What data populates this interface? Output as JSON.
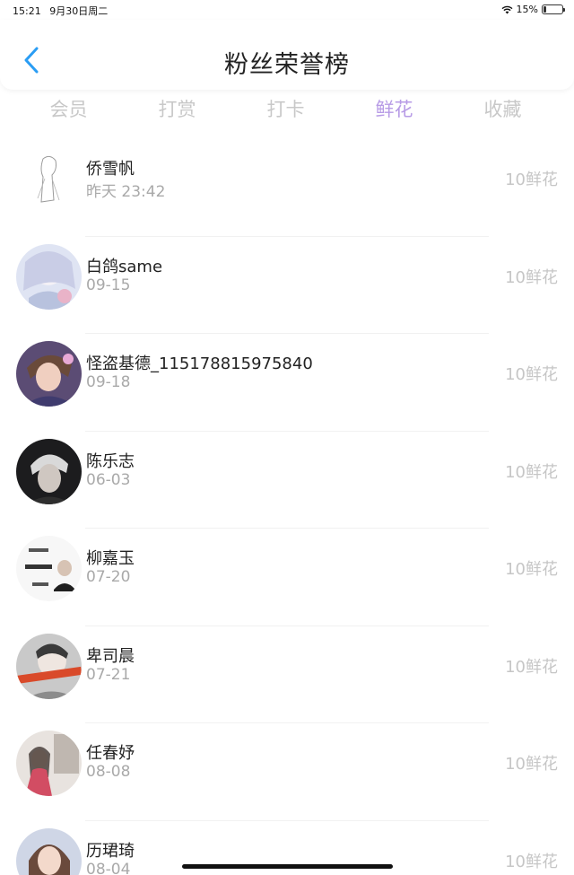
{
  "status_bar": {
    "time": "15:21",
    "date": "9月30日周二",
    "battery_text": "15%",
    "battery_level": 0.15
  },
  "header": {
    "title": "粉丝荣誉榜",
    "back_icon": "chevron-left-icon",
    "accent": "#2a9df4"
  },
  "tabs": [
    {
      "label": "会员",
      "active": false
    },
    {
      "label": "打赏",
      "active": false
    },
    {
      "label": "打卡",
      "active": false
    },
    {
      "label": "鲜花",
      "active": true
    },
    {
      "label": "收藏",
      "active": false
    }
  ],
  "active_tab_color": "#b79be6",
  "fans": [
    {
      "name": "侨雪帆",
      "date": "昨天 23:42",
      "amount": "10鲜花"
    },
    {
      "name": "白鸽same",
      "date": "09-15",
      "amount": "10鲜花"
    },
    {
      "name": "怪盗基德_115178815975840",
      "date": "09-18",
      "amount": "10鲜花"
    },
    {
      "name": "陈乐志",
      "date": "06-03",
      "amount": "10鲜花"
    },
    {
      "name": "柳嘉玉",
      "date": "07-20",
      "amount": "10鲜花"
    },
    {
      "name": "卑司晨",
      "date": "07-21",
      "amount": "10鲜花"
    },
    {
      "name": "任春妤",
      "date": "08-08",
      "amount": "10鲜花"
    },
    {
      "name": "历珺琦",
      "date": "08-04",
      "amount": "10鲜花"
    }
  ]
}
